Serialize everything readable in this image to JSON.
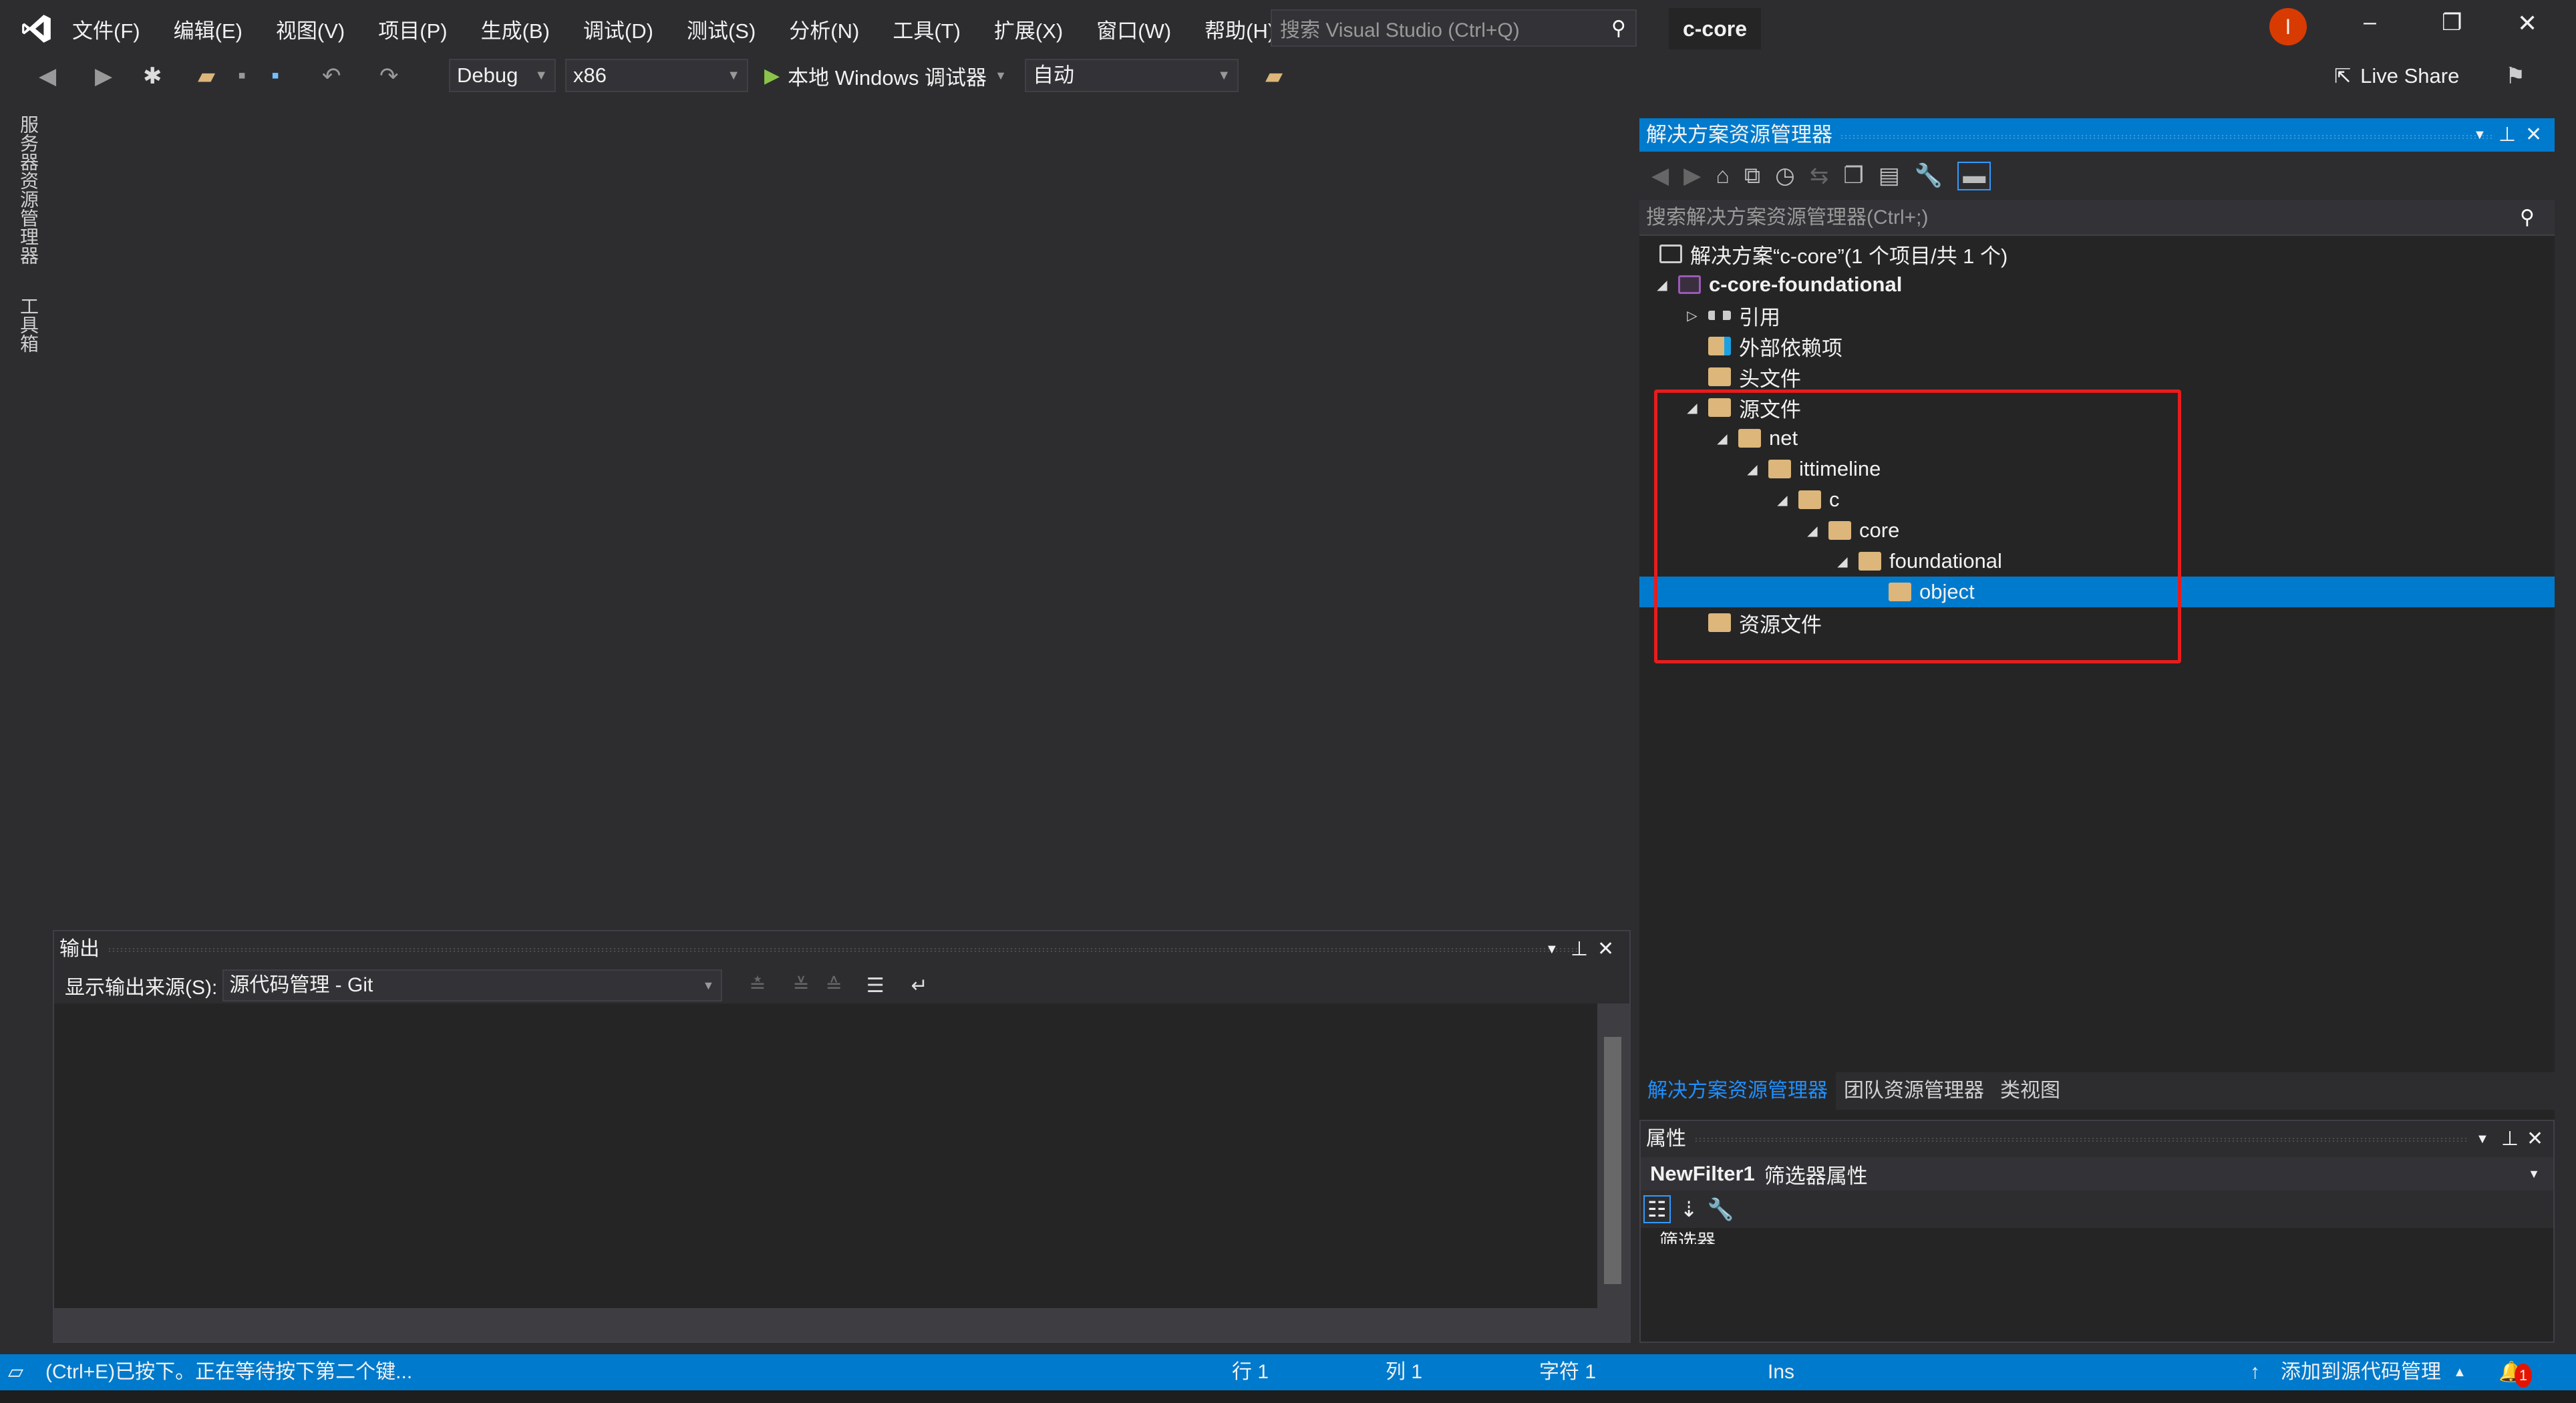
{
  "menu": [
    "文件(F)",
    "编辑(E)",
    "视图(V)",
    "项目(P)",
    "生成(B)",
    "调试(D)",
    "测试(S)",
    "分析(N)",
    "工具(T)",
    "扩展(X)",
    "窗口(W)",
    "帮助(H)"
  ],
  "search_placeholder": "搜索 Visual Studio (Ctrl+Q)",
  "window_title": "c-core",
  "user_badge": "I",
  "toolbar": {
    "config": "Debug",
    "platform": "x86",
    "run_label": "本地 Windows 调试器",
    "run_mode": "自动",
    "live_share": "Live Share"
  },
  "left_strip": [
    "服务器资源管理器",
    "工具箱"
  ],
  "output": {
    "title": "输出",
    "source_label": "显示输出来源(S):",
    "source_value": "源代码管理 - Git"
  },
  "solution_explorer": {
    "title": "解决方案资源管理器",
    "search_placeholder": "搜索解决方案资源管理器(Ctrl+;)",
    "tree": [
      {
        "label": "解决方案“c-core”(1 个项目/共 1 个)",
        "depth": 0,
        "expander": "none",
        "icon": "solution-icon"
      },
      {
        "label": "c-core-foundational",
        "depth": 0,
        "expander": "expanded",
        "icon": "cpp-project-icon",
        "bold": true
      },
      {
        "label": "引用",
        "depth": 1,
        "expander": "collapsed",
        "icon": "references-icon"
      },
      {
        "label": "外部依赖项",
        "depth": 1,
        "expander": "none",
        "icon": "external-deps-icon"
      },
      {
        "label": "头文件",
        "depth": 1,
        "expander": "none",
        "icon": "filter-folder-icon"
      },
      {
        "label": "源文件",
        "depth": 1,
        "expander": "expanded",
        "icon": "filter-folder-icon"
      },
      {
        "label": "net",
        "depth": 2,
        "expander": "expanded",
        "icon": "filter-folder-icon"
      },
      {
        "label": "ittimeline",
        "depth": 3,
        "expander": "expanded",
        "icon": "filter-folder-icon"
      },
      {
        "label": "c",
        "depth": 4,
        "expander": "expanded",
        "icon": "filter-folder-icon"
      },
      {
        "label": "core",
        "depth": 5,
        "expander": "expanded",
        "icon": "filter-folder-icon"
      },
      {
        "label": "foundational",
        "depth": 6,
        "expander": "expanded",
        "icon": "filter-folder-icon"
      },
      {
        "label": "object",
        "depth": 7,
        "expander": "none",
        "icon": "filter-folder-icon",
        "selected": true
      },
      {
        "label": "资源文件",
        "depth": 1,
        "expander": "none",
        "icon": "filter-folder-icon"
      }
    ]
  },
  "tabs": [
    "解决方案资源管理器",
    "团队资源管理器",
    "类视图"
  ],
  "properties": {
    "title": "属性",
    "object_name": "NewFilter1",
    "object_type": "筛选器属性",
    "category": "筛选器"
  },
  "status": {
    "message": "(Ctrl+E)已按下。正在等待按下第二个键...",
    "line": "行 1",
    "col": "列 1",
    "char": "字符 1",
    "mode": "Ins",
    "source_control": "添加到源代码管理",
    "notifications": "1"
  },
  "colors": {
    "accent": "#007acc",
    "highlight": "#e81c1c",
    "folder": "#dcb67a"
  }
}
